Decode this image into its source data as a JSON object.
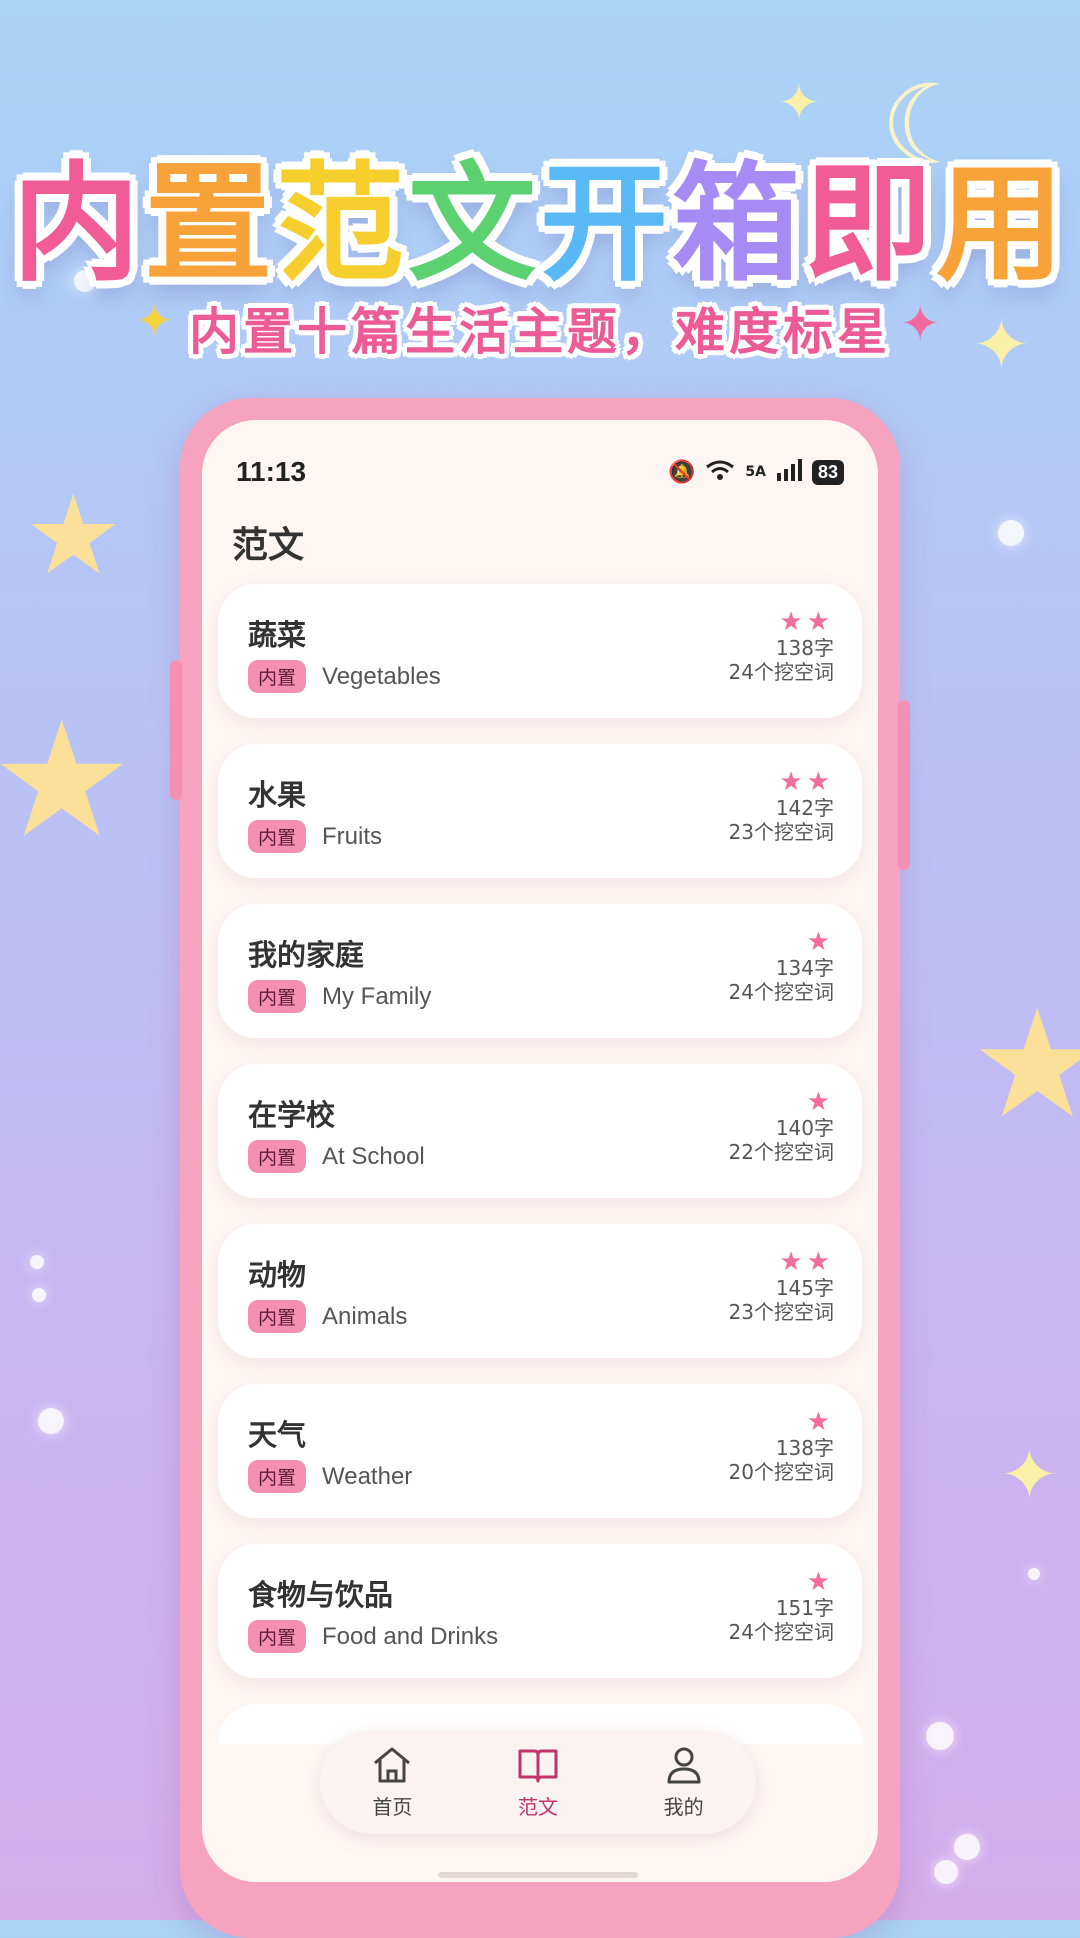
{
  "headline": {
    "chars": [
      {
        "ch": "内",
        "color": "#f25c96"
      },
      {
        "ch": "置",
        "color": "#f8a23a"
      },
      {
        "ch": "范",
        "color": "#f6cf2f"
      },
      {
        "ch": "文",
        "color": "#5bd170"
      },
      {
        "ch": "开",
        "color": "#58b9f5"
      },
      {
        "ch": "箱",
        "color": "#a78bf5"
      },
      {
        "ch": "即",
        "color": "#f25c96"
      },
      {
        "ch": "用",
        "color": "#f8a23a"
      }
    ]
  },
  "subhead": "内置十篇生活主题，难度标星",
  "status_bar": {
    "time": "11:13",
    "network": "5A",
    "battery": "83"
  },
  "page": {
    "title": "范文"
  },
  "essays": [
    {
      "title": "蔬菜",
      "tag": "内置",
      "english": "Vegetables",
      "stars": "★★",
      "words": "138字",
      "blanks": "24个挖空词"
    },
    {
      "title": "水果",
      "tag": "内置",
      "english": "Fruits",
      "stars": "★★",
      "words": "142字",
      "blanks": "23个挖空词"
    },
    {
      "title": "我的家庭",
      "tag": "内置",
      "english": "My Family",
      "stars": "★",
      "words": "134字",
      "blanks": "24个挖空词"
    },
    {
      "title": "在学校",
      "tag": "内置",
      "english": "At School",
      "stars": "★",
      "words": "140字",
      "blanks": "22个挖空词"
    },
    {
      "title": "动物",
      "tag": "内置",
      "english": "Animals",
      "stars": "★★",
      "words": "145字",
      "blanks": "23个挖空词"
    },
    {
      "title": "天气",
      "tag": "内置",
      "english": "Weather",
      "stars": "★",
      "words": "138字",
      "blanks": "20个挖空词"
    },
    {
      "title": "食物与饮品",
      "tag": "内置",
      "english": "Food and Drinks",
      "stars": "★",
      "words": "151字",
      "blanks": "24个挖空词"
    }
  ],
  "tabbar": {
    "items": [
      {
        "label": "首页",
        "icon": "home-icon",
        "active": false
      },
      {
        "label": "范文",
        "icon": "book-icon",
        "active": true
      },
      {
        "label": "我的",
        "icon": "user-icon",
        "active": false
      }
    ]
  },
  "colors": {
    "accent": "#ef6e9c",
    "active_tab": "#c2336b",
    "frame": "#f6a3bf"
  }
}
